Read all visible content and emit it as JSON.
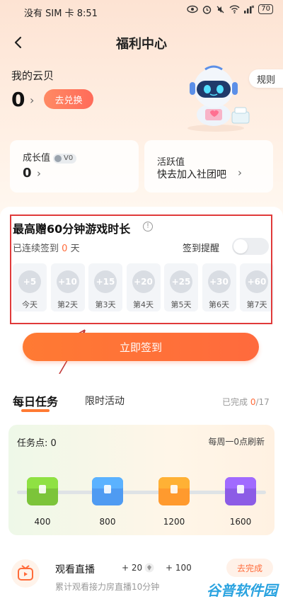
{
  "status_bar": {
    "carrier_time": "没有 SIM 卡 8:51",
    "battery": "70"
  },
  "header": {
    "title": "福利中心",
    "rules": "规则"
  },
  "balance": {
    "label": "我的云贝",
    "value": "0",
    "arrow": "›",
    "exchange": "去兑换"
  },
  "stats": {
    "growth": {
      "label": "成长值",
      "level": "V0",
      "value": "0",
      "arrow": "›"
    },
    "active": {
      "label": "活跃值",
      "value": "快去加入社团吧",
      "arrow": "›"
    }
  },
  "signin": {
    "title": "最高赠60分钟游戏时长",
    "info": "!",
    "streak_prefix": "已连续签到",
    "streak_days": "0",
    "streak_suffix": "天",
    "reminder": "签到提醒",
    "reminder_on": false,
    "days": [
      {
        "reward": "+5",
        "label": "今天"
      },
      {
        "reward": "+10",
        "label": "第2天"
      },
      {
        "reward": "+15",
        "label": "第3天"
      },
      {
        "reward": "+20",
        "label": "第4天"
      },
      {
        "reward": "+25",
        "label": "第5天"
      },
      {
        "reward": "+30",
        "label": "第6天"
      },
      {
        "reward": "+60",
        "label": "第7天"
      }
    ],
    "button": "立即签到"
  },
  "tasks": {
    "tab_daily": "每日任务",
    "tab_limited": "限时活动",
    "completed_prefix": "已完成",
    "completed_count": "0",
    "completed_total": "/17",
    "points_label": "任务点: 0",
    "refresh_note": "每周一0点刷新",
    "milestones": [
      "400",
      "800",
      "1200",
      "1600"
    ],
    "chest_colors": [
      "#7cc43a",
      "#4f9bf2",
      "#ff9a2e",
      "#8c5ce6"
    ],
    "live": {
      "title": "观看直播",
      "desc": "累计观看接力房直播10分钟",
      "reward1": "+ 20",
      "reward2": "+ 100",
      "button": "去完成"
    }
  },
  "watermark": "谷普软件园"
}
